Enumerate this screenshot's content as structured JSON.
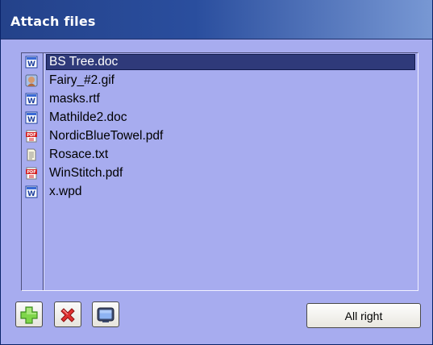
{
  "window": {
    "title": "Attach files"
  },
  "files": [
    {
      "name": "BS Tree.doc",
      "icon": "word-doc-icon",
      "selected": true
    },
    {
      "name": "Fairy_#2.gif",
      "icon": "image-icon",
      "selected": false
    },
    {
      "name": "masks.rtf",
      "icon": "word-doc-icon",
      "selected": false
    },
    {
      "name": "Mathilde2.doc",
      "icon": "word-doc-icon",
      "selected": false
    },
    {
      "name": "NordicBlueTowel.pdf",
      "icon": "pdf-icon",
      "selected": false
    },
    {
      "name": "Rosace.txt",
      "icon": "text-file-icon",
      "selected": false
    },
    {
      "name": "WinStitch.pdf",
      "icon": "pdf-icon",
      "selected": false
    },
    {
      "name": "x.wpd",
      "icon": "word-doc-icon",
      "selected": false
    }
  ],
  "toolbar": {
    "add_icon": "plus-icon",
    "remove_icon": "red-x-icon",
    "view_icon": "monitor-icon",
    "ok_label": "All right"
  },
  "colors": {
    "titlebar_start": "#24428a",
    "titlebar_end": "#7898d4",
    "panel_background": "#a7acef",
    "selection": "#2f3a7a"
  }
}
